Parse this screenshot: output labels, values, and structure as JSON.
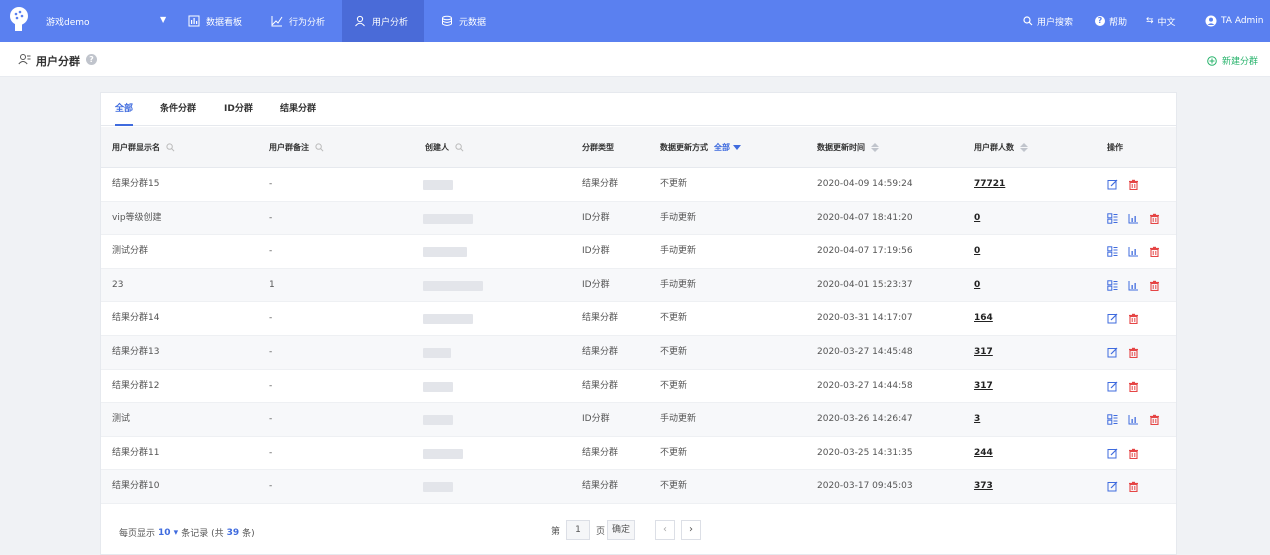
{
  "nav": {
    "project": "游戏demo",
    "items": [
      {
        "label": "数据看板",
        "icon": "dashboard-icon"
      },
      {
        "label": "行为分析",
        "icon": "trend-icon"
      },
      {
        "label": "用户分析",
        "icon": "user-icon",
        "active": true
      },
      {
        "label": "元数据",
        "icon": "database-icon"
      }
    ],
    "right": {
      "user_search": "用户搜索",
      "help": "帮助",
      "language": "中文",
      "account": "TA Admin"
    }
  },
  "subheader": {
    "title": "用户分群",
    "new_button": "新建分群"
  },
  "tabs": [
    "全部",
    "条件分群",
    "ID分群",
    "结果分群"
  ],
  "table": {
    "columns": {
      "name": "用户群显示名",
      "remark": "用户群备注",
      "creator": "创建人",
      "type": "分群类型",
      "update_mode": "数据更新方式",
      "update_mode_filter": "全部",
      "update_time": "数据更新时间",
      "count": "用户群人数",
      "ops": "操作"
    },
    "rows": [
      {
        "name": "结果分群15",
        "remark": "-",
        "type": "结果分群",
        "mode": "不更新",
        "time": "2020-04-09 14:59:24",
        "count": "77721"
      },
      {
        "name": "vip等级创建",
        "remark": "-",
        "type": "ID分群",
        "mode": "手动更新",
        "time": "2020-04-07 18:41:20",
        "count": "0"
      },
      {
        "name": "测试分群",
        "remark": "-",
        "type": "ID分群",
        "mode": "手动更新",
        "time": "2020-04-07 17:19:56",
        "count": "0"
      },
      {
        "name": "23",
        "remark": "1",
        "type": "ID分群",
        "mode": "手动更新",
        "time": "2020-04-01 15:23:37",
        "count": "0"
      },
      {
        "name": "结果分群14",
        "remark": "-",
        "type": "结果分群",
        "mode": "不更新",
        "time": "2020-03-31 14:17:07",
        "count": "164"
      },
      {
        "name": "结果分群13",
        "remark": "-",
        "type": "结果分群",
        "mode": "不更新",
        "time": "2020-03-27 14:45:48",
        "count": "317"
      },
      {
        "name": "结果分群12",
        "remark": "-",
        "type": "结果分群",
        "mode": "不更新",
        "time": "2020-03-27 14:44:58",
        "count": "317"
      },
      {
        "name": "测试",
        "remark": "-",
        "type": "ID分群",
        "mode": "手动更新",
        "time": "2020-03-26 14:26:47",
        "count": "3"
      },
      {
        "name": "结果分群11",
        "remark": "-",
        "type": "结果分群",
        "mode": "不更新",
        "time": "2020-03-25 14:31:35",
        "count": "244"
      },
      {
        "name": "结果分群10",
        "remark": "-",
        "type": "结果分群",
        "mode": "不更新",
        "time": "2020-03-17 09:45:03",
        "count": "373"
      }
    ]
  },
  "footer": {
    "per_page_prefix": "每页显示",
    "per_page_value": "10",
    "per_page_suffix": "条记录 (共",
    "total": "39",
    "total_suffix": "条)",
    "page_prefix": "第",
    "page_value": "1",
    "page_suffix": "页",
    "confirm": "确定"
  },
  "colors": {
    "nav_bg": "#5a80f0",
    "accent": "#3f6bde",
    "new_button": "#27b36b",
    "delete": "#e54545"
  }
}
